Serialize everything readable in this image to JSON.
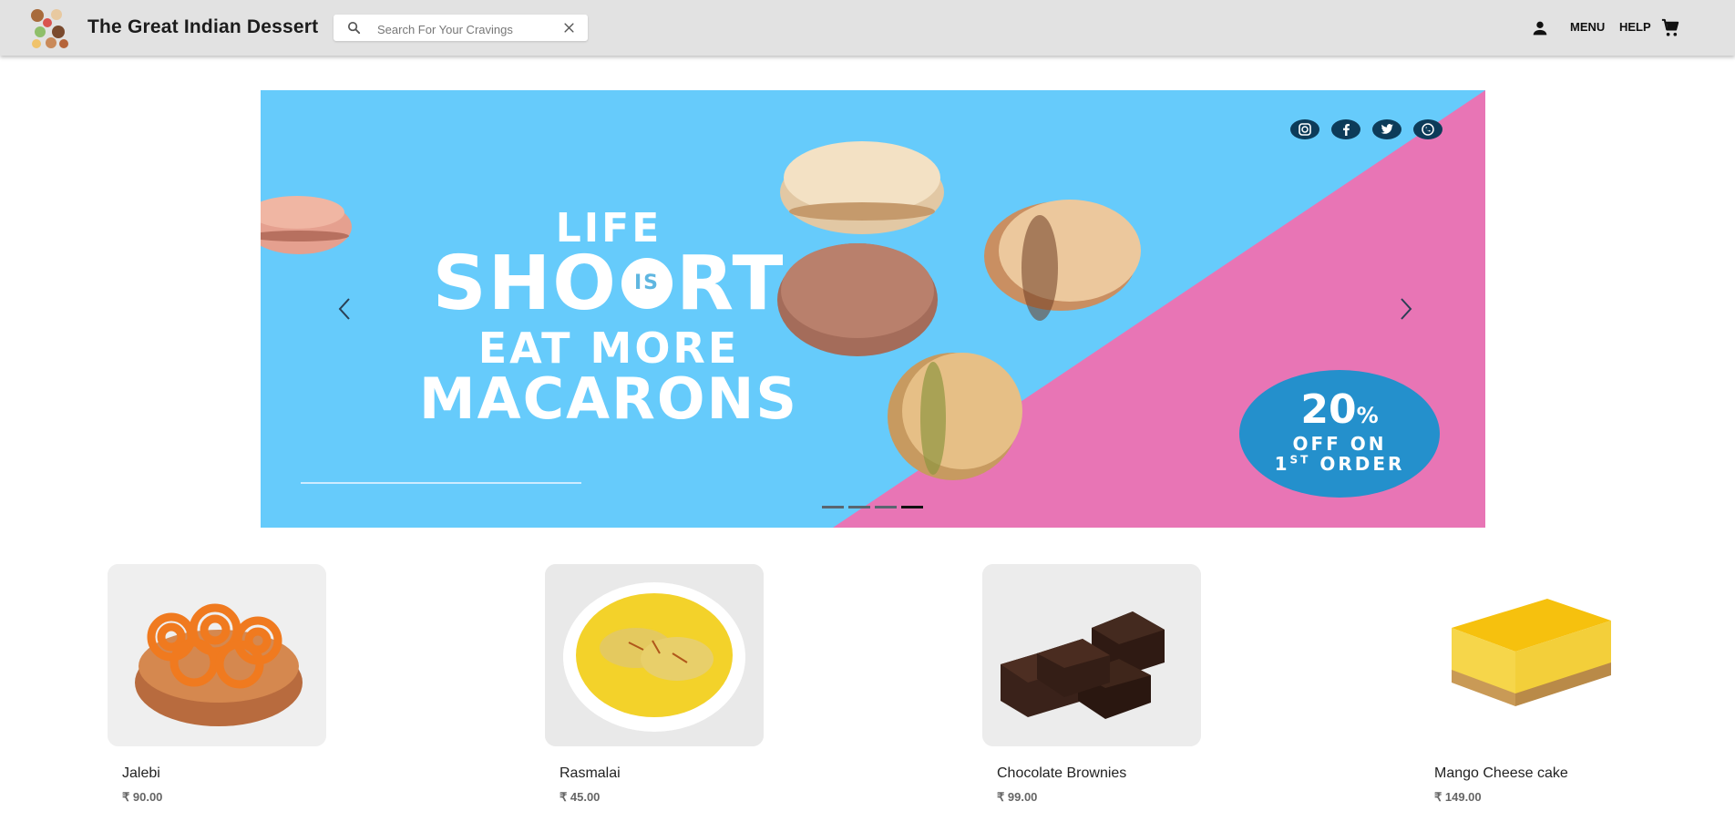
{
  "header": {
    "brand": "The Great Indian Dessert",
    "search_placeholder": "Search For Your Cravings",
    "menu_label": "MENU",
    "help_label": "HELP",
    "icons": [
      "logo",
      "search-icon",
      "close-icon",
      "user-icon",
      "cart-icon"
    ]
  },
  "banner": {
    "line1": "LIFE",
    "line2a": "SHO",
    "line2_is": "IS",
    "line2b": "RT",
    "line3": "EAT MORE",
    "line4": "MACARONS",
    "offer_percent": "20",
    "offer_percent_sign": "%",
    "offer_line2": "OFF ON",
    "offer_line3_num": "1",
    "offer_line3_sup": "ST",
    "offer_line3_word": "ORDER",
    "slides_total": 4,
    "active_slide": 4,
    "socials": [
      "instagram-icon",
      "facebook-icon",
      "twitter-icon",
      "whatsapp-icon"
    ],
    "colors": {
      "sky": "#66cbfb",
      "pink": "#e875b5",
      "offer": "#2490cc"
    }
  },
  "products": [
    {
      "name": "Jalebi",
      "price": "₹ 90.00"
    },
    {
      "name": "Rasmalai",
      "price": "₹ 45.00"
    },
    {
      "name": "Chocolate Brownies",
      "price": "₹ 99.00"
    },
    {
      "name": "Mango Cheese cake",
      "price": "₹ 149.00"
    }
  ]
}
